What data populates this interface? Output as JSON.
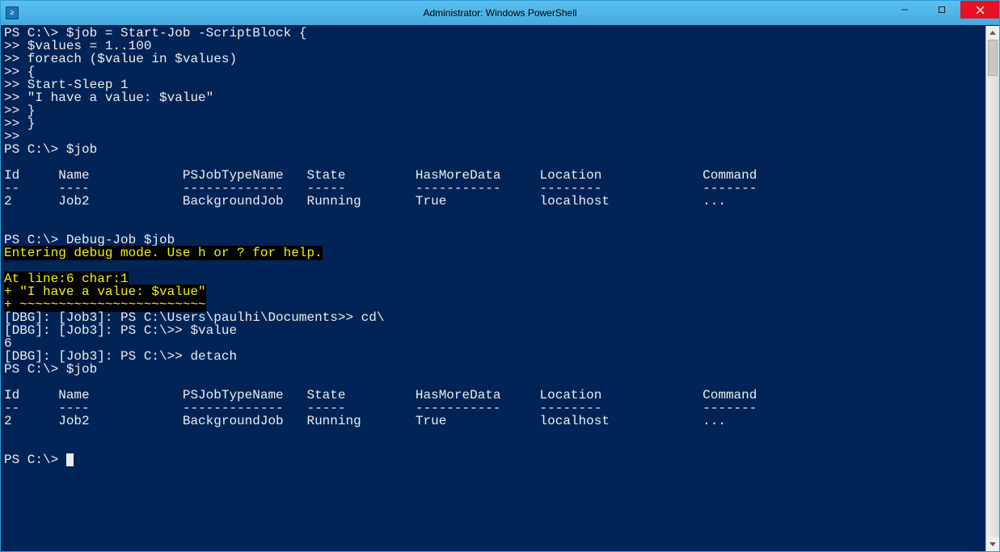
{
  "window": {
    "title": "Administrator: Windows PowerShell",
    "icon_glyph": "≥"
  },
  "buttons": {
    "minimize": "–",
    "maximize": "□",
    "close": "✕"
  },
  "lines": [
    {
      "t": "PS C:\\> $job = Start-Job -ScriptBlock {"
    },
    {
      "t": ">> $values = 1..100"
    },
    {
      "t": ">> foreach ($value in $values)"
    },
    {
      "t": ">> {"
    },
    {
      "t": ">> Start-Sleep 1"
    },
    {
      "t": ">> \"I have a value: $value\""
    },
    {
      "t": ">> }"
    },
    {
      "t": ">> }"
    },
    {
      "t": ">>"
    },
    {
      "t": "PS C:\\> $job"
    },
    {
      "t": ""
    },
    {
      "t": "Id     Name            PSJobTypeName   State         HasMoreData     Location             Command"
    },
    {
      "t": "--     ----            -------------   -----         -----------     --------             -------"
    },
    {
      "t": "2      Job2            BackgroundJob   Running       True            localhost            ..."
    },
    {
      "t": ""
    },
    {
      "t": ""
    },
    {
      "t": "PS C:\\> Debug-Job $job"
    },
    {
      "t": "Entering debug mode. Use h or ? for help.",
      "hl": true
    },
    {
      "t": ""
    },
    {
      "t": "At line:6 char:1",
      "hl": true
    },
    {
      "t": "+ \"I have a value: $value\"",
      "hl": true
    },
    {
      "t": "+ ~~~~~~~~~~~~~~~~~~~~~~~~",
      "hl": true
    },
    {
      "t": "[DBG]: [Job3]: PS C:\\Users\\paulhi\\Documents>> cd\\"
    },
    {
      "t": "[DBG]: [Job3]: PS C:\\>> $value"
    },
    {
      "t": "6"
    },
    {
      "t": "[DBG]: [Job3]: PS C:\\>> detach"
    },
    {
      "t": "PS C:\\> $job"
    },
    {
      "t": ""
    },
    {
      "t": "Id     Name            PSJobTypeName   State         HasMoreData     Location             Command"
    },
    {
      "t": "--     ----            -------------   -----         -----------     --------             -------"
    },
    {
      "t": "2      Job2            BackgroundJob   Running       True            localhost            ..."
    },
    {
      "t": ""
    },
    {
      "t": ""
    },
    {
      "t": "PS C:\\> ",
      "cursor": true
    }
  ]
}
